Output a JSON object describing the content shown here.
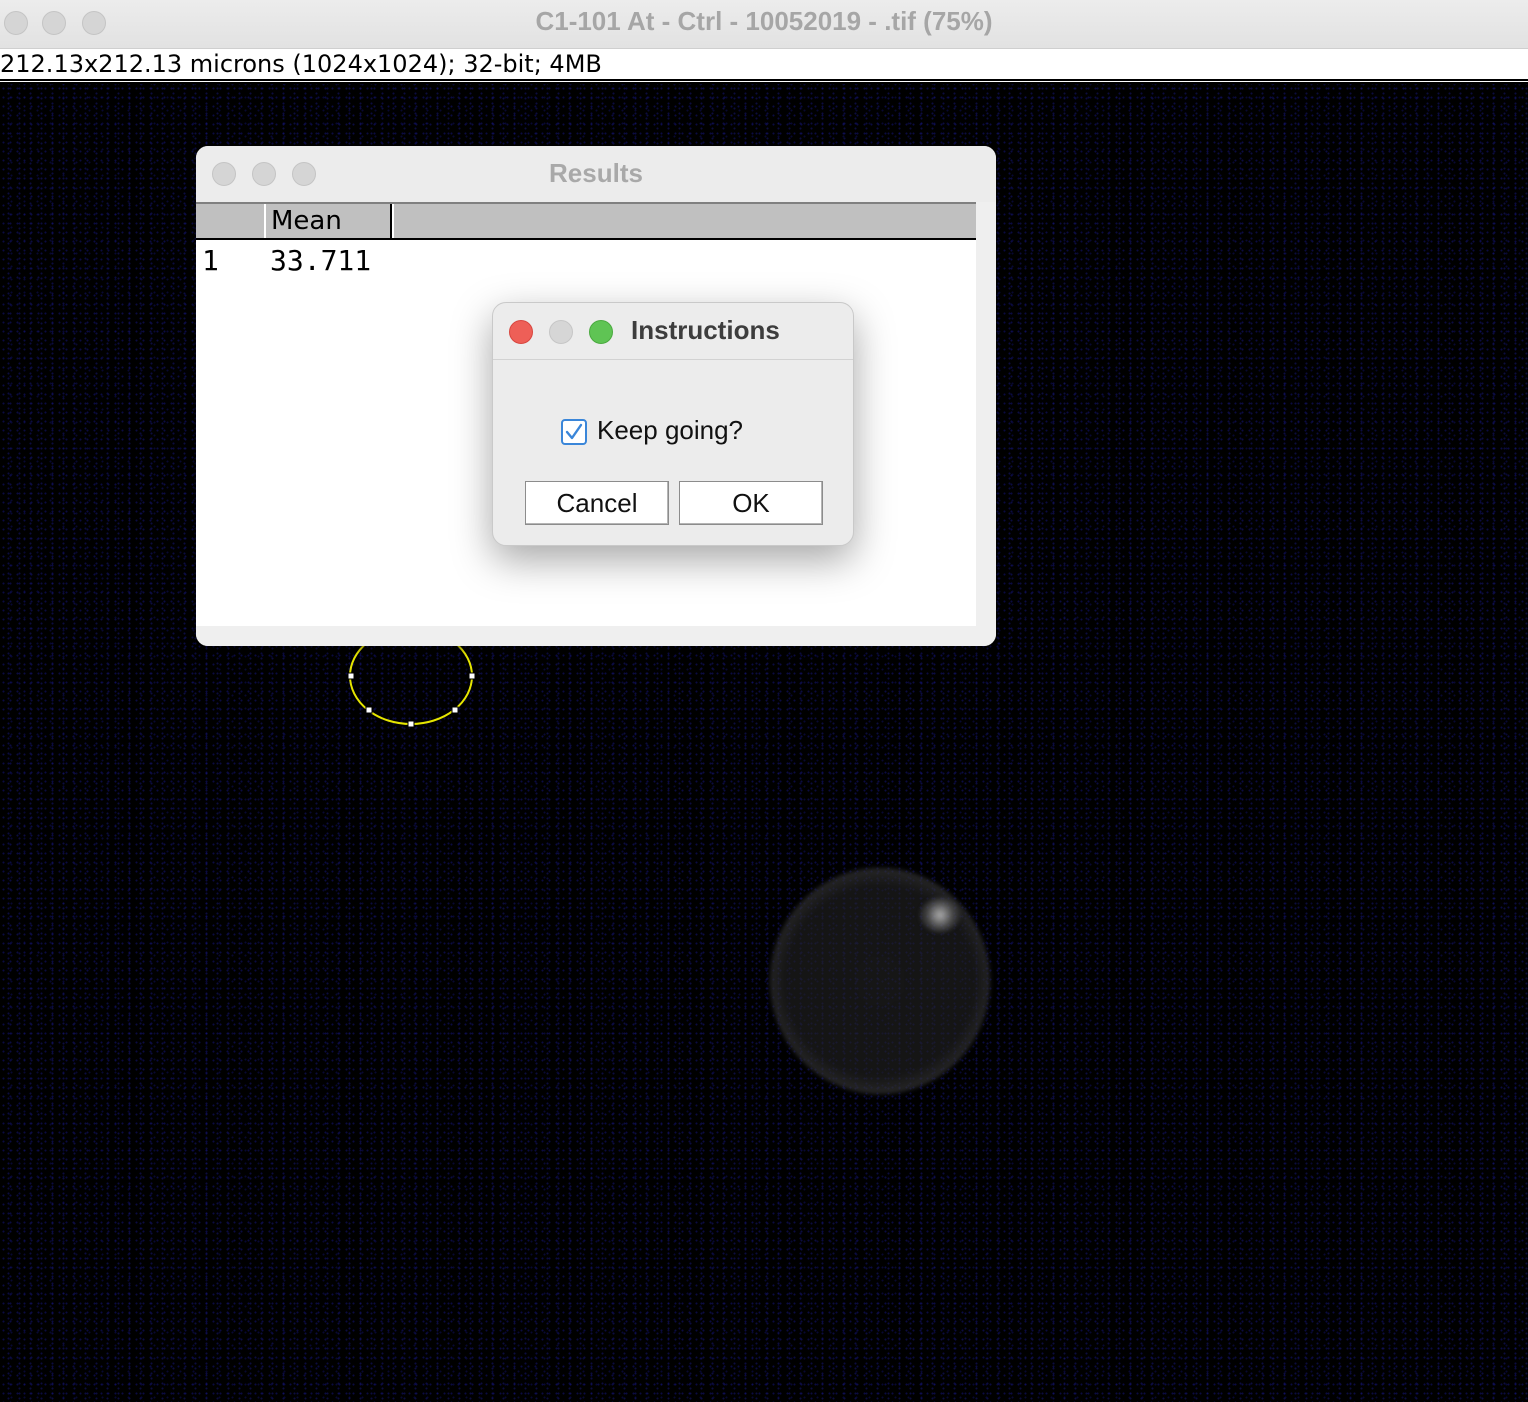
{
  "main_window": {
    "title": "C1-101 At - Ctrl - 10052019 - .tif (75%)",
    "info": "212.13x212.13 microns (1024x1024); 32-bit; 4MB"
  },
  "results_window": {
    "title": "Results",
    "columns": [
      "",
      "Mean"
    ],
    "rows": [
      {
        "index": "1",
        "mean": "33.711"
      }
    ]
  },
  "instructions_dialog": {
    "title": "Instructions",
    "checkbox_label": "Keep going?",
    "checkbox_checked": true,
    "cancel_label": "Cancel",
    "ok_label": "OK"
  },
  "colors": {
    "roi": "#e6e600",
    "close": "#ee5f57",
    "maximize": "#5fc454",
    "checkbox_accent": "#3a86d9"
  },
  "icons": [
    "close-dot-icon",
    "minimize-dot-icon",
    "maximize-dot-icon",
    "checkmark-icon"
  ]
}
